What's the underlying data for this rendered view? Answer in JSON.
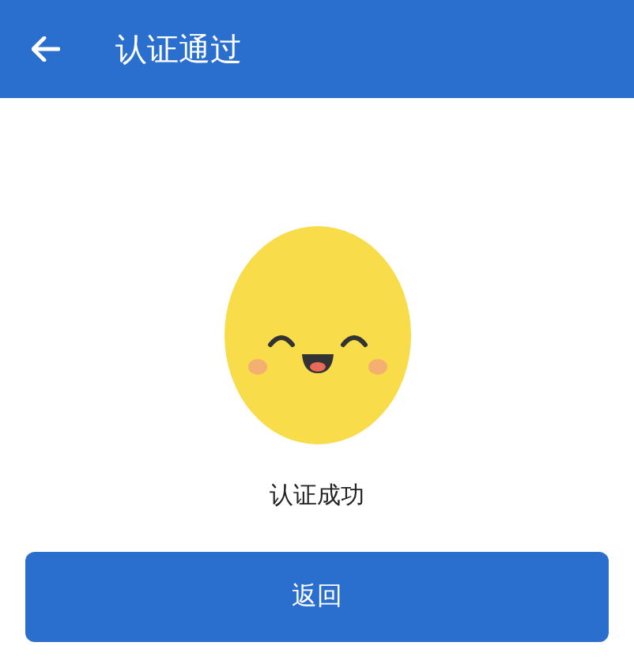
{
  "header": {
    "title": "认证通过"
  },
  "result": {
    "message": "认证成功"
  },
  "button": {
    "label": "返回"
  }
}
